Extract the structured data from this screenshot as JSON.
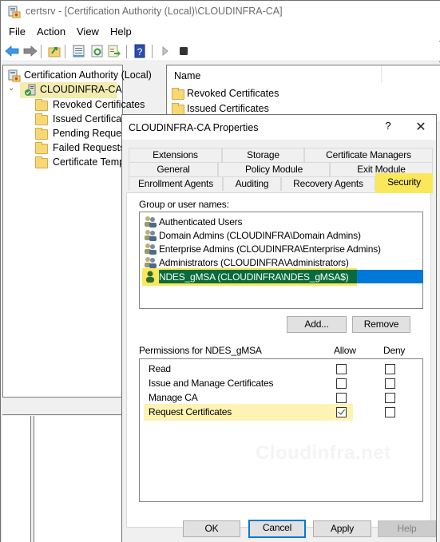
{
  "window": {
    "title": "certsrv - [Certification Authority (Local)\\CLOUDINFRA-CA]",
    "icon": "certsrv-icon"
  },
  "menu": [
    "File",
    "Action",
    "View",
    "Help"
  ],
  "toolbar": {
    "buttons": [
      "back-icon",
      "forward-icon",
      "up-folder-icon",
      "properties-icon",
      "refresh-icon",
      "export-list-icon",
      "help-icon",
      "start-service-icon",
      "stop-service-icon"
    ]
  },
  "tree": {
    "root": "Certification Authority (Local)",
    "ca": "CLOUDINFRA-CA",
    "children": [
      "Revoked Certificates",
      "Issued Certificates",
      "Pending Requests",
      "Failed Requests",
      "Certificate Templates"
    ]
  },
  "list": {
    "column_name": "Name",
    "items": [
      "Revoked Certificates",
      "Issued Certificates"
    ]
  },
  "dialog": {
    "title": "CLOUDINFRA-CA Properties",
    "help_label": "?",
    "close_label": "✕",
    "tabs_row1": [
      "Extensions",
      "Storage",
      "Certificate Managers"
    ],
    "tabs_row2": [
      "General",
      "Policy Module",
      "Exit Module"
    ],
    "tabs_row3": [
      "Enrollment Agents",
      "Auditing",
      "Recovery Agents",
      "Security"
    ],
    "active_tab": "Security",
    "group_label": "Group or user names:",
    "users": [
      "Authenticated Users",
      "Domain Admins (CLOUDINFRA\\Domain Admins)",
      "Enterprise Admins (CLOUDINFRA\\Enterprise Admins)",
      "Administrators (CLOUDINFRA\\Administrators)",
      "NDES_gMSA (CLOUDINFRA\\NDES_gMSA$)"
    ],
    "selected_user": "NDES_gMSA (CLOUDINFRA\\NDES_gMSA$)",
    "add_label": "Add...",
    "remove_label": "Remove",
    "permissions_label": "Permissions for NDES_gMSA",
    "allow_label": "Allow",
    "deny_label": "Deny",
    "permissions": [
      {
        "name": "Read",
        "allow": false,
        "deny": false
      },
      {
        "name": "Issue and Manage Certificates",
        "allow": false,
        "deny": false
      },
      {
        "name": "Manage CA",
        "allow": false,
        "deny": false
      },
      {
        "name": "Request Certificates",
        "allow": true,
        "deny": false
      }
    ],
    "ok_label": "OK",
    "cancel_label": "Cancel",
    "apply_label": "Apply",
    "help_button_label": "Help"
  },
  "watermark": "Cloudinfra.net",
  "colors": {
    "highlight_yellow": "#fbe85a",
    "selection_blue": "#0078d7",
    "selection_green": "#076b3b",
    "permission_highlight": "#fdf3b2"
  }
}
